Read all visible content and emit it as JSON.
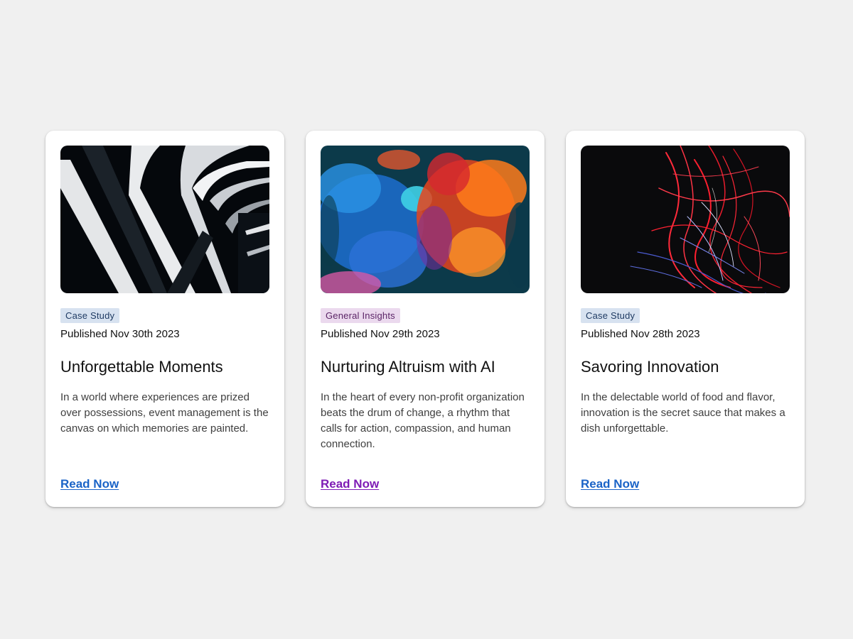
{
  "colors": {
    "page_background": "#f0f0f0",
    "card_background": "#ffffff",
    "link_blue": "#1a63c7",
    "link_visited_purple": "#7e1bb5",
    "tag_case_study_bg": "#d7e2f0",
    "tag_general_insights_bg": "#ebd9ee"
  },
  "cards": [
    {
      "image": "abstract-black-white-curved-architecture",
      "tag": "Case Study",
      "date": "Published Nov 30th 2023",
      "title": "Unforgettable Moments",
      "description": "In a world where experiences are prized over possessions, event management is the canvas on which memories are painted.",
      "link": "Read Now"
    },
    {
      "image": "blue-red-ink-cloud",
      "tag": "General Insights",
      "date": "Published Nov 29th 2023",
      "title": "Nurturing Altruism with AI",
      "description": "In the heart of every non-profit organization beats the drum of change, a rhythm that calls for action, compassion, and human connection.",
      "link": "Read Now"
    },
    {
      "image": "red-light-streaks-on-black",
      "tag": "Case Study",
      "date": "Published Nov 28th 2023",
      "title": "Savoring Innovation",
      "description": "In the delectable world of food and flavor, innovation is the secret sauce that makes a dish unforgettable.",
      "link": "Read Now"
    }
  ]
}
